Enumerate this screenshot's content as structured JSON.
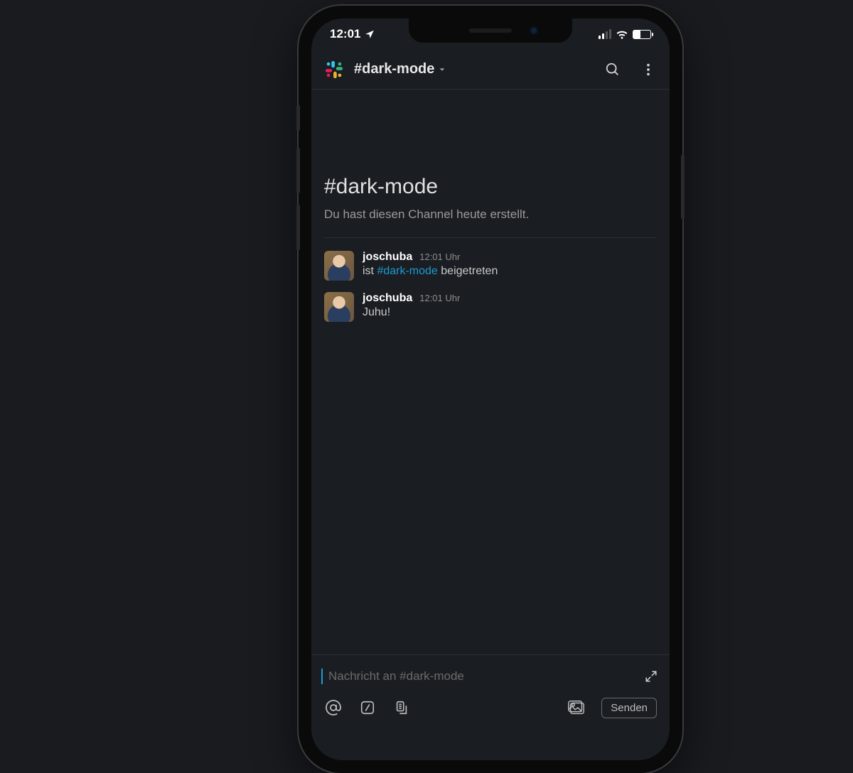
{
  "statusbar": {
    "time": "12:01"
  },
  "header": {
    "channel": "#dark-mode"
  },
  "intro": {
    "title": "#dark-mode",
    "subtitle": "Du hast diesen Channel heute erstellt."
  },
  "messages": [
    {
      "user": "joschuba",
      "time": "12:01 Uhr",
      "text_prefix": "ist ",
      "channel_ref": "#dark-mode",
      "text_suffix": " beigetreten"
    },
    {
      "user": "joschuba",
      "time": "12:01 Uhr",
      "text": "Juhu!"
    }
  ],
  "composer": {
    "placeholder": "Nachricht an #dark-mode",
    "send": "Senden"
  }
}
